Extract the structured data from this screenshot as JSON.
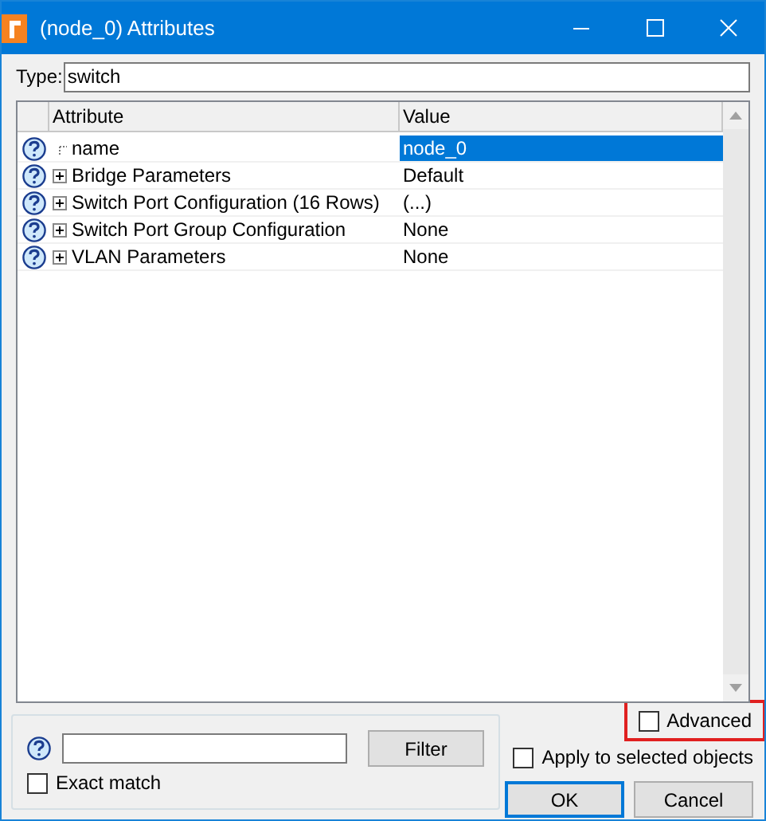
{
  "window": {
    "title": "(node_0) Attributes"
  },
  "type_field": {
    "label": "Type:",
    "value": "switch"
  },
  "table": {
    "columns": [
      "Attribute",
      "Value"
    ],
    "rows": [
      {
        "attribute": "name",
        "value": "node_0",
        "expandable": false,
        "selected": true
      },
      {
        "attribute": "Bridge Parameters",
        "value": "Default",
        "expandable": true,
        "selected": false
      },
      {
        "attribute": "Switch Port Configuration (16 Rows)",
        "value": "(...)",
        "expandable": true,
        "selected": false
      },
      {
        "attribute": "Switch Port Group Configuration",
        "value": "None",
        "expandable": true,
        "selected": false
      },
      {
        "attribute": "VLAN Parameters",
        "value": "None",
        "expandable": true,
        "selected": false
      }
    ]
  },
  "filter": {
    "button": "Filter",
    "exact_match": {
      "label": "Exact match",
      "checked": false
    }
  },
  "advanced": {
    "label": "Advanced",
    "checked": false,
    "highlighted": true
  },
  "apply_to_selected": {
    "label": "Apply to selected objects",
    "checked": false
  },
  "buttons": [
    "OK",
    "Cancel"
  ]
}
